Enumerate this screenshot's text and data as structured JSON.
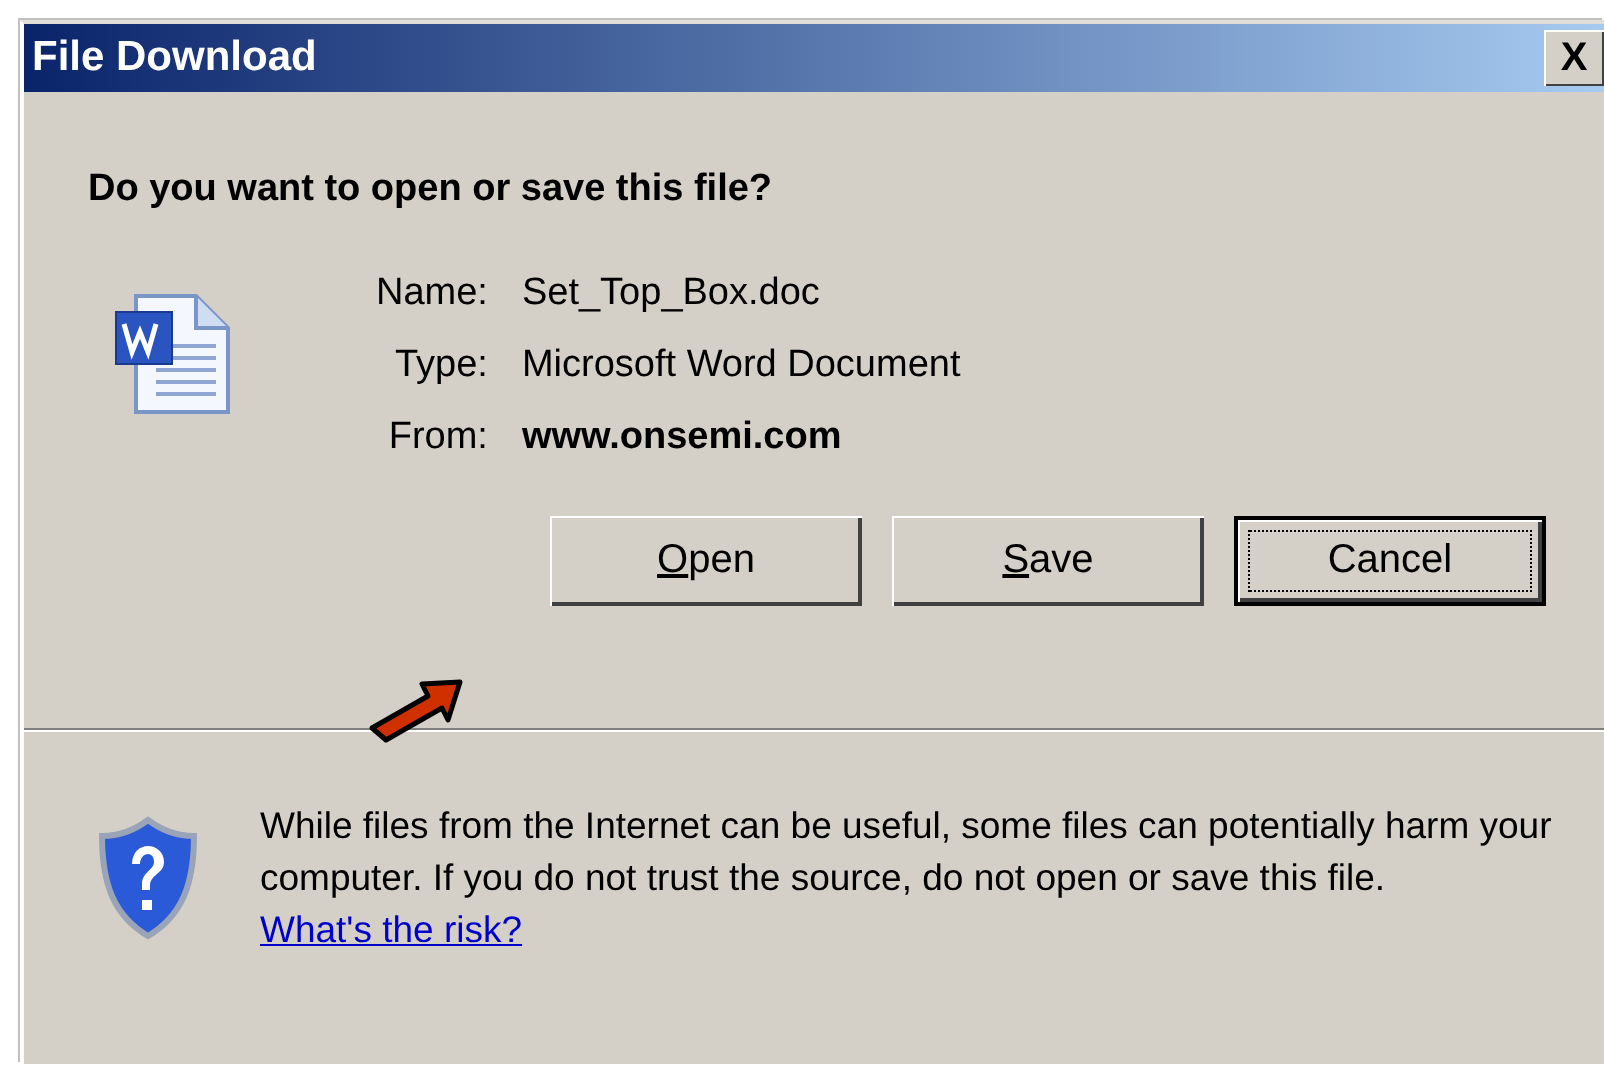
{
  "window": {
    "title": "File Download",
    "close_label": "X"
  },
  "question": "Do you want to open or save this file?",
  "file_info": [
    {
      "label": "Name:",
      "value": "Set_Top_Box.doc",
      "bold": false
    },
    {
      "label": "Type:",
      "value": "Microsoft Word Document",
      "bold": false
    },
    {
      "label": "From:",
      "value": "www.onsemi.com",
      "bold": true
    }
  ],
  "buttons": [
    {
      "label": "Open",
      "underline_first": true,
      "default": false
    },
    {
      "label": "Save",
      "underline_first": true,
      "default": false
    },
    {
      "label": "Cancel",
      "underline_first": false,
      "default": true
    }
  ],
  "warning": {
    "text": "While files from the Internet can be useful, some files can potentially harm your computer. If you do not trust the source, do not open or save this file.",
    "link": "What's the risk?"
  }
}
